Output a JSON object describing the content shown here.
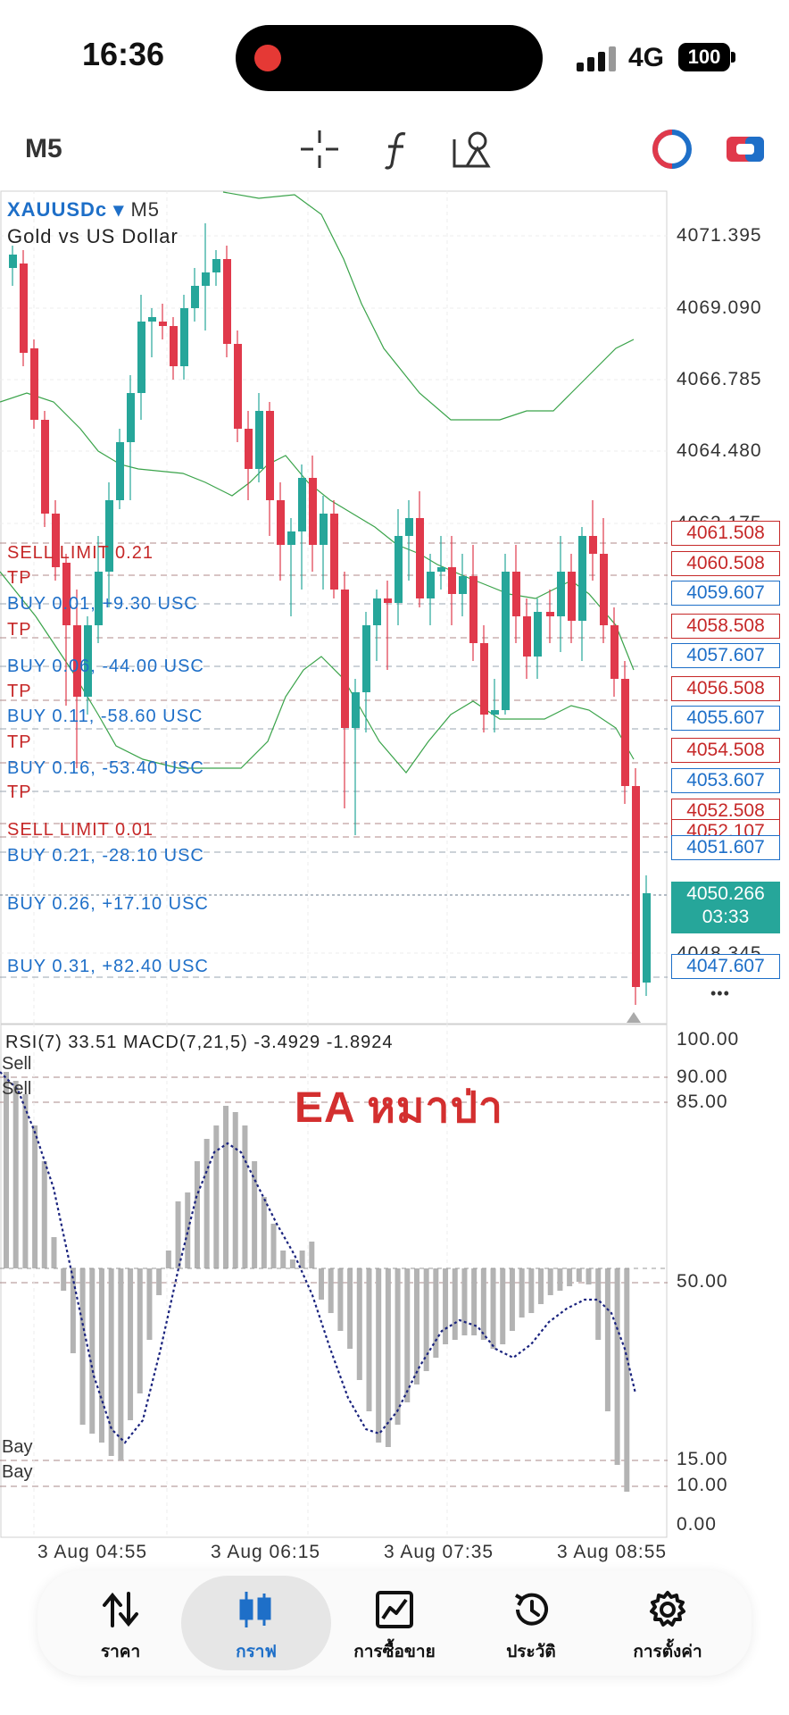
{
  "status_bar": {
    "time": "16:36",
    "network": "4G",
    "battery": "100"
  },
  "toolbar": {
    "timeframe": "M5",
    "icons": [
      "crosshair-icon",
      "indicators-icon",
      "objects-icon",
      "one-click-trading-icon",
      "trade-mode-icon"
    ]
  },
  "chart": {
    "symbol": "XAUUSDc",
    "symbol_dropdown": "▾",
    "timeframe": "M5",
    "description": "Gold vs US Dollar",
    "price_scale": [
      "4071.395",
      "4069.090",
      "4066.785",
      "4064.480",
      "4062.175",
      "4048.345"
    ],
    "order_lines": [
      {
        "label": "SELL LIMIT 0.21",
        "price": "4061.508",
        "side": "sell"
      },
      {
        "label": "TP",
        "price": "4060.508",
        "side": "sell"
      },
      {
        "label": "BUY 0.01, +9.30 USC",
        "price": "4059.607",
        "side": "buy"
      },
      {
        "label": "TP",
        "price": "4058.508",
        "side": "sell"
      },
      {
        "label": "BUY 0.06, -44.00 USC",
        "price": "4057.607",
        "side": "buy"
      },
      {
        "label": "TP",
        "price": "4056.508",
        "side": "sell"
      },
      {
        "label": "BUY 0.11, -58.60 USC",
        "price": "4055.607",
        "side": "buy"
      },
      {
        "label": "TP",
        "price": "4054.508",
        "side": "sell"
      },
      {
        "label": "BUY 0.16, -53.40 USC",
        "price": "4053.607",
        "side": "buy"
      },
      {
        "label": "TP",
        "price": "4052.508",
        "side": "sell"
      },
      {
        "label": "SELL LIMIT 0.01",
        "price": "4052.107",
        "side": "sell"
      },
      {
        "label": "BUY 0.21, -28.10 USC",
        "price": "4051.607",
        "side": "buy"
      },
      {
        "label": "BUY 0.26, +17.10 USC",
        "price": "4050.266",
        "side": "buy"
      },
      {
        "label": "BUY 0.31, +82.40 USC",
        "price": "4047.607",
        "side": "buy"
      }
    ],
    "current_price": "4050.266",
    "countdown": "03:33",
    "more": "•••",
    "colors": {
      "bull": "#26a69a",
      "bear": "#e0394b",
      "bands": "#3aa34a",
      "buy": "#1e6fc8",
      "sell": "#c62828"
    }
  },
  "indicator": {
    "title": "RSI(7) 33.51 MACD(7,21,5) -3.4929 -1.8924",
    "watermark": "EA หมาป่า",
    "level_labels": [
      "Sell",
      "Sell",
      "Bay",
      "Bay"
    ],
    "scale": [
      "100.00",
      "90.00",
      "85.00",
      "50.00",
      "15.00",
      "10.00",
      "0.00"
    ]
  },
  "time_axis": [
    "3 Aug 04:55",
    "3 Aug 06:15",
    "3 Aug 07:35",
    "3 Aug 08:55"
  ],
  "nav": [
    {
      "label": "ราคา",
      "icon": "quotes-icon"
    },
    {
      "label": "กราฟ",
      "icon": "chart-icon",
      "active": true
    },
    {
      "label": "การซื้อขาย",
      "icon": "trade-icon"
    },
    {
      "label": "ประวัติ",
      "icon": "history-icon"
    },
    {
      "label": "การตั้งค่า",
      "icon": "settings-icon"
    }
  ]
}
